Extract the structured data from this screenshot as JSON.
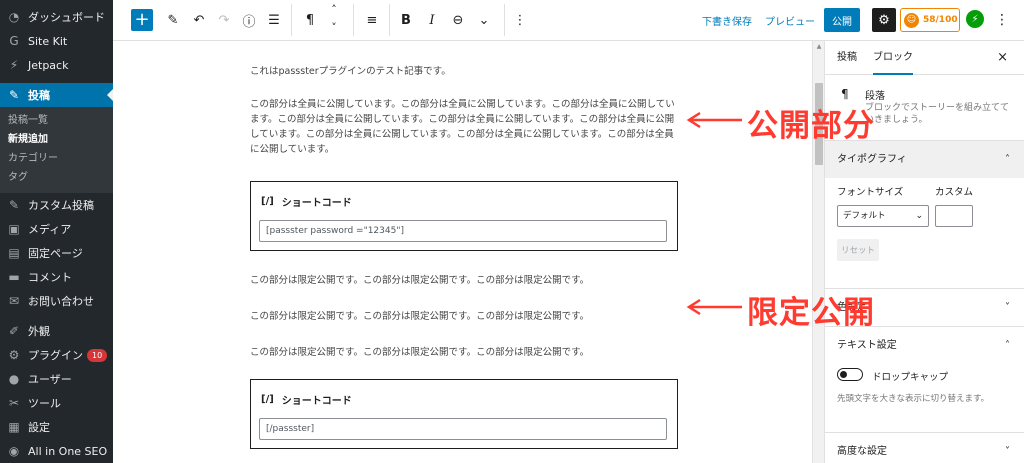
{
  "admin_menu": {
    "items": [
      {
        "icon": "dashboard-icon",
        "glyph": "◔",
        "label": "ダッシュボード"
      },
      {
        "icon": "sitekit-icon",
        "glyph": "G",
        "label": "Site Kit"
      },
      {
        "icon": "jetpack-icon",
        "glyph": "⚡",
        "label": "Jetpack"
      }
    ],
    "current": {
      "icon": "pin-icon",
      "glyph": "✎",
      "label": "投稿"
    },
    "submenu": [
      "投稿一覧",
      "新規追加",
      "カテゴリー",
      "タグ"
    ],
    "submenu_active": "新規追加",
    "items2": [
      {
        "icon": "pin-icon",
        "glyph": "✎",
        "label": "カスタム投稿"
      },
      {
        "icon": "media-icon",
        "glyph": "▣",
        "label": "メディア"
      },
      {
        "icon": "page-icon",
        "glyph": "▤",
        "label": "固定ページ"
      },
      {
        "icon": "comment-icon",
        "glyph": "▬",
        "label": "コメント"
      },
      {
        "icon": "mail-icon",
        "glyph": "✉",
        "label": "お問い合わせ"
      }
    ],
    "items3": [
      {
        "icon": "brush-icon",
        "glyph": "✐",
        "label": "外観"
      },
      {
        "icon": "plugin-icon",
        "glyph": "⚙",
        "label": "プラグイン",
        "badge": "10"
      },
      {
        "icon": "user-icon",
        "glyph": "●",
        "label": "ユーザー"
      },
      {
        "icon": "wrench-icon",
        "glyph": "✂",
        "label": "ツール"
      },
      {
        "icon": "settings-icon",
        "glyph": "▦",
        "label": "設定"
      },
      {
        "icon": "aioseo-icon",
        "glyph": "◉",
        "label": "All in One SEO"
      }
    ]
  },
  "toolbar": {
    "add_glyph": "+",
    "tools": [
      "✎",
      "↶",
      "↷",
      "ⓘ",
      "☰"
    ],
    "para_glyph": "¶",
    "move_up": "˄",
    "move_down": "˅",
    "align_glyph": "≡",
    "bold": "B",
    "italic": "I",
    "link_glyph": "⊖",
    "more_rich": "⌄",
    "options": "⋮",
    "save_draft": "下書き保存",
    "preview": "プレビュー",
    "publish": "公開",
    "settings_glyph": "⚙",
    "seo_score": "58/100",
    "seo_glyph": "☺",
    "jetpack_glyph": "⚡",
    "more": "⋮"
  },
  "editor": {
    "paragraph1": "これはpasssterプラグインのテスト記事です。",
    "paragraph2": "この部分は全員に公開しています。この部分は全員に公開しています。この部分は全員に公開しています。この部分は全員に公開しています。この部分は全員に公開しています。この部分は全員に公開しています。この部分は全員に公開しています。この部分は全員に公開しています。この部分は全員に公開しています。",
    "shortcode1": {
      "icon": "[/]",
      "label": "ショートコード",
      "value": "[passster password =\"12345\"]"
    },
    "paragraph3": "この部分は限定公開です。この部分は限定公開です。この部分は限定公開です。",
    "paragraph4": "この部分は限定公開です。この部分は限定公開です。この部分は限定公開です。",
    "paragraph5": "この部分は限定公開です。この部分は限定公開です。この部分は限定公開です。",
    "shortcode2": {
      "icon": "[/]",
      "label": "ショートコード",
      "value": "[/passster]"
    }
  },
  "sidebar": {
    "tab_post": "投稿",
    "tab_block": "ブロック",
    "close": "×",
    "block_icon": "¶",
    "block_title": "段落",
    "block_desc": "ブロックでストーリーを組み立てていきましょう。",
    "typography": "タイポグラフィ",
    "font_size": "フォントサイズ",
    "custom": "カスタム",
    "default": "デフォルト",
    "reset": "リセット",
    "color_settings": "色設定",
    "text_settings": "テキスト設定",
    "drop_cap": "ドロップキャップ",
    "drop_cap_help": "先頭文字を大きな表示に切り替えます。",
    "advanced": "高度な設定",
    "chev_up": "˄",
    "chev_down": "˅"
  },
  "annotations": {
    "public": "公開部分",
    "limited": "限定公開",
    "color": "#ff3b30"
  }
}
